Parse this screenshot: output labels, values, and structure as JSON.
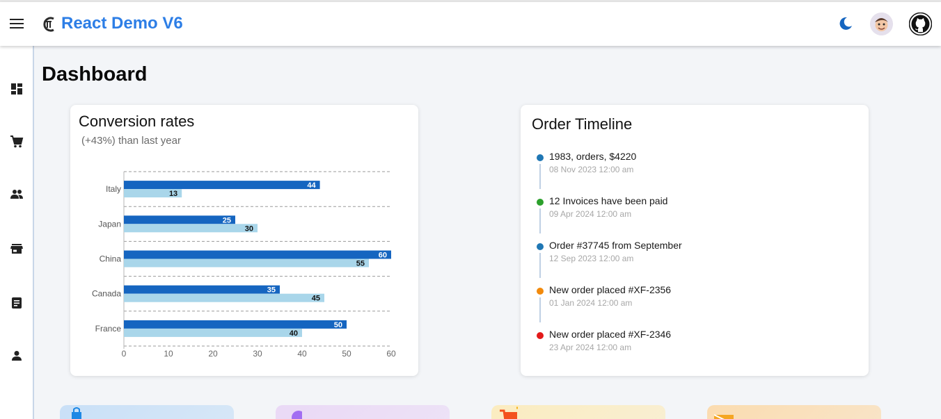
{
  "app": {
    "title": "React Demo V6"
  },
  "header": {
    "menu_icon": "menu-icon",
    "logo_icon": "react-demo-logo-icon",
    "theme_icon": "moon-icon",
    "avatar_icon": "avatar-icon",
    "github_icon": "github-icon"
  },
  "sidebar": {
    "items": [
      {
        "icon": "dashboard-icon"
      },
      {
        "icon": "cart-icon"
      },
      {
        "icon": "people-icon"
      },
      {
        "icon": "store-icon"
      },
      {
        "icon": "article-icon"
      },
      {
        "icon": "person-icon"
      }
    ]
  },
  "page": {
    "title": "Dashboard"
  },
  "conversion": {
    "title": "Conversion rates",
    "subtitle": "(+43%) than last year"
  },
  "chart_data": {
    "type": "bar",
    "orientation": "horizontal",
    "categories": [
      "Italy",
      "Japan",
      "China",
      "Canada",
      "France"
    ],
    "series": [
      {
        "values": [
          44,
          25,
          60,
          35,
          50
        ],
        "color": "#1565c0"
      },
      {
        "values": [
          13,
          30,
          55,
          45,
          40
        ],
        "color": "#a9d6ea"
      }
    ],
    "xlim": [
      0,
      60
    ],
    "xticks": [
      0,
      10,
      20,
      30,
      40,
      50,
      60
    ],
    "grid": "horizontal dashed",
    "data_labels": true
  },
  "timeline": {
    "title": "Order Timeline",
    "items": [
      {
        "text": "1983, orders, $4220",
        "time": "08 Nov 2023 12:00 am",
        "color": "#1f77b4"
      },
      {
        "text": "12 Invoices have been paid",
        "time": "09 Apr 2024 12:00 am",
        "color": "#2ca02c"
      },
      {
        "text": "Order #37745 from September",
        "time": "12 Sep 2023 12:00 am",
        "color": "#1f77b4"
      },
      {
        "text": "New order placed #XF-2356",
        "time": "01 Jan 2024 12:00 am",
        "color": "#f28a0c"
      },
      {
        "text": "New order placed #XF-2346",
        "time": "23 Apr 2024 12:00 am",
        "color": "#e31a1a"
      }
    ]
  },
  "stats": [
    {
      "icon": "shopping-bag-icon",
      "color": "#c9e0f7"
    },
    {
      "icon": "user-circle-icon",
      "color": "#ead9f6"
    },
    {
      "icon": "shopping-cart-icon",
      "color": "#fbecc0"
    },
    {
      "icon": "mail-icon",
      "color": "#fbdcb0"
    }
  ]
}
